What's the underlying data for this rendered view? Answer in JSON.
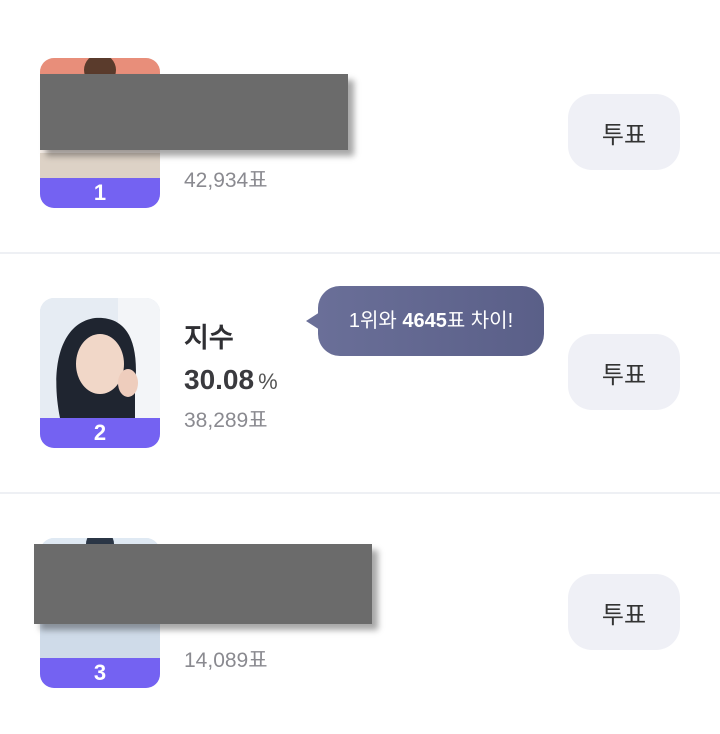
{
  "ranking": [
    {
      "rank": "1",
      "name": "",
      "percent": "",
      "percent_unit": "%",
      "votes": "42,934표",
      "vote_button": "투표",
      "redacted": true
    },
    {
      "rank": "2",
      "name": "지수",
      "percent": "30.08",
      "percent_unit": "%",
      "votes": "38,289표",
      "vote_button": "투표",
      "redacted": false
    },
    {
      "rank": "3",
      "name": "",
      "percent": "",
      "percent_unit": "%",
      "votes": "14,089표",
      "vote_button": "투표",
      "redacted": true
    }
  ],
  "tooltip": {
    "prefix": "1위와 ",
    "gap": "4645",
    "suffix": "표 차이!"
  },
  "colors": {
    "rank_band": "#7462f2",
    "button_bg": "#eff0f6",
    "tooltip_bg": "#62678f",
    "redaction": "#6b6b6b"
  }
}
